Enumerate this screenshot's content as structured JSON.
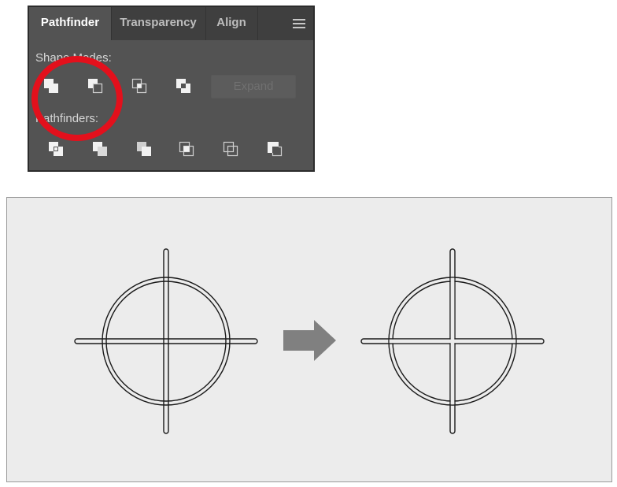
{
  "panel": {
    "tabs": [
      {
        "label": "Pathfinder",
        "active": true
      },
      {
        "label": "Transparency",
        "active": false
      },
      {
        "label": "Align",
        "active": false
      }
    ],
    "menu_icon": "hamburger-menu-icon",
    "shape_modes": {
      "label": "Shape Modes:",
      "tools": [
        "unite-icon",
        "minus-front-icon",
        "intersect-icon",
        "exclude-icon"
      ],
      "expand_label": "Expand"
    },
    "pathfinders": {
      "label": "Pathfinders:",
      "tools": [
        "divide-icon",
        "trim-icon",
        "merge-icon",
        "crop-icon",
        "outline-icon",
        "minus-back-icon"
      ]
    },
    "highlight_color": "#e3101c"
  },
  "illustration": {
    "background": "#ececec",
    "arrow_color": "#808080",
    "before": "crosshair-circle-overlapping",
    "after": "crosshair-circle-united"
  }
}
